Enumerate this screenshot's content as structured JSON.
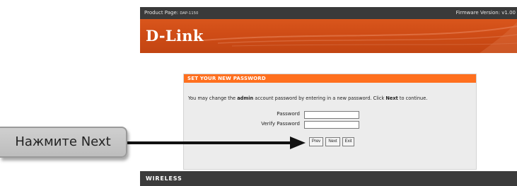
{
  "top_bar": {
    "product_label": "Product Page:",
    "model": "DAP-1150",
    "firmware": "Firmware Version: v1.00"
  },
  "banner": {
    "logo_text": "D-Link"
  },
  "panel": {
    "header": "SET YOUR NEW PASSWORD",
    "desc_1": "You may change the ",
    "desc_bold_1": "admin",
    "desc_2": " account password by entering in a new password. Click ",
    "desc_bold_2": "Next",
    "desc_3": " to continue.",
    "password_label": "Password",
    "verify_label": "Verify Password",
    "password_value": "",
    "verify_value": "",
    "prev_label": "Prev",
    "next_label": "Next",
    "exit_label": "Exit"
  },
  "callout": {
    "text": "Нажмите Next"
  },
  "footer": {
    "wireless_label": "WIRELESS"
  },
  "colors": {
    "panel_header": "#ff6f1e",
    "banner": "#d9561c",
    "dark_bar": "#3a3a3a"
  }
}
